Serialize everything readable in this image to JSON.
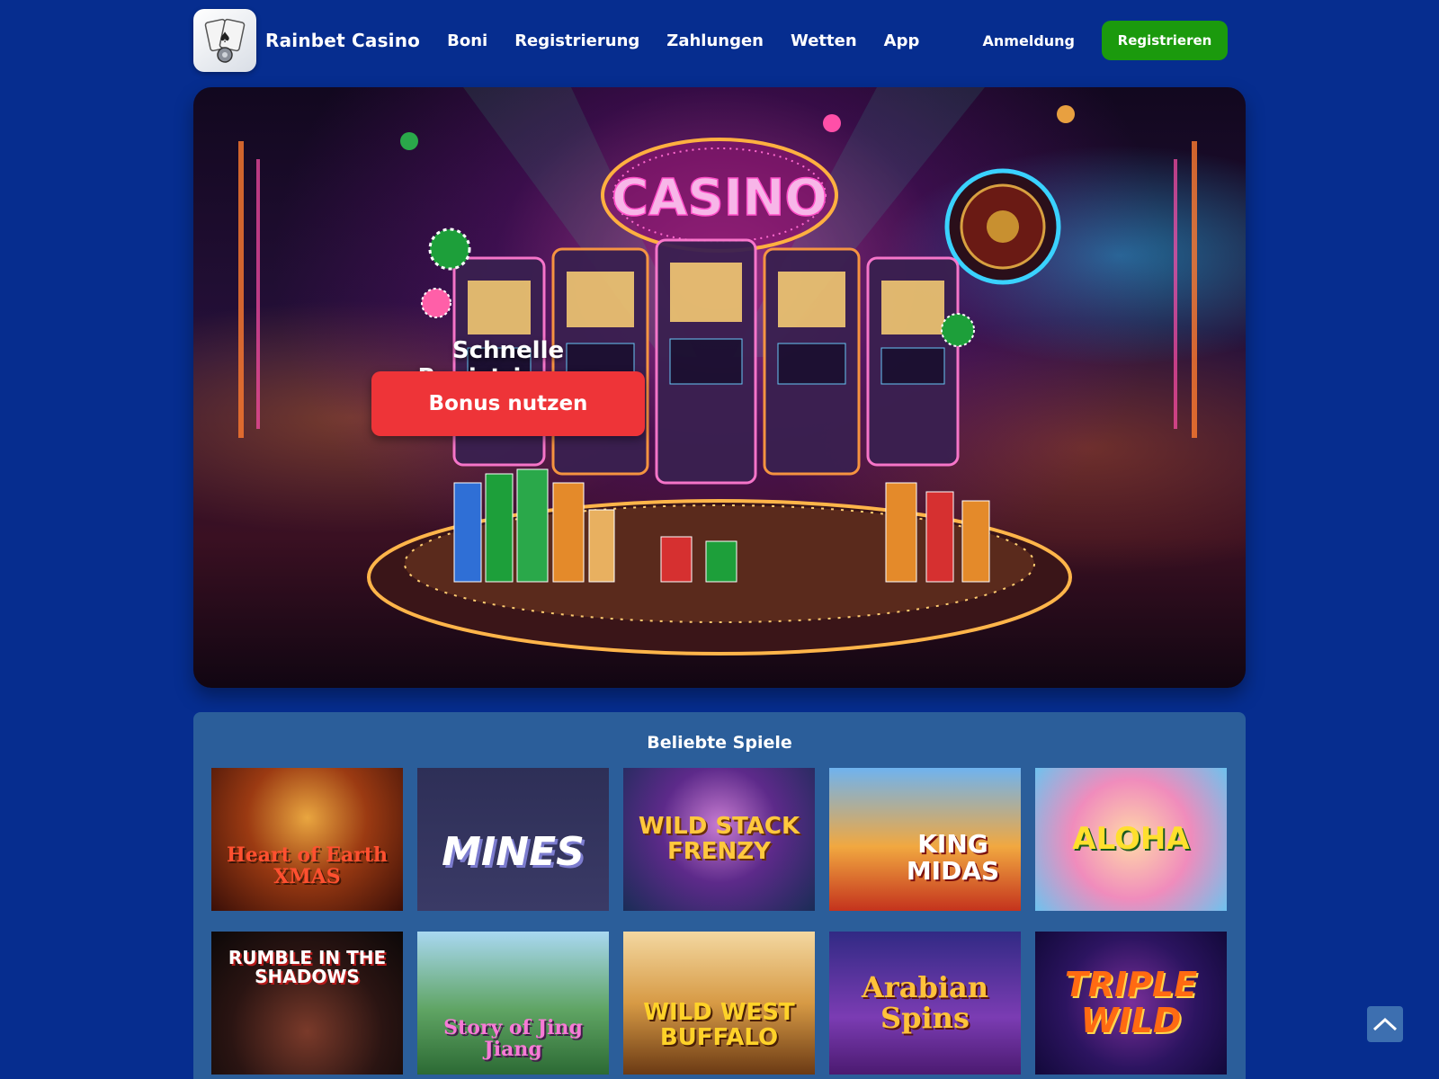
{
  "header": {
    "brand": "Rainbet Casino",
    "nav": [
      "Boni",
      "Registrierung",
      "Zahlungen",
      "Wetten",
      "App"
    ],
    "login": "Anmeldung",
    "register": "Registrieren"
  },
  "hero": {
    "sign_text": "CASINO",
    "title": "Schnelle Registrierung",
    "button": "Bonus nutzen"
  },
  "games": {
    "title": "Beliebte Spiele",
    "items": [
      {
        "name": "Heart of Earth XMAS"
      },
      {
        "name": "MINES"
      },
      {
        "name": "WILD STACK FRENZY"
      },
      {
        "name": "KING MIDAS"
      },
      {
        "name": "ALOHA"
      },
      {
        "name": "RUMBLE IN THE SHADOWS"
      },
      {
        "name": "Story of Jing Jiang"
      },
      {
        "name": "WILD WEST BUFFALO"
      },
      {
        "name": "Arabian Spins"
      },
      {
        "name": "TRIPLE WILD"
      }
    ]
  },
  "colors": {
    "background": "#062d8f",
    "register_button": "#1b9a0d",
    "hero_button": "#ee3438",
    "games_panel": "#2b5e9a"
  },
  "icons": {
    "logo": "playing-cards-icon",
    "scroll_top": "chevron-up-icon"
  }
}
